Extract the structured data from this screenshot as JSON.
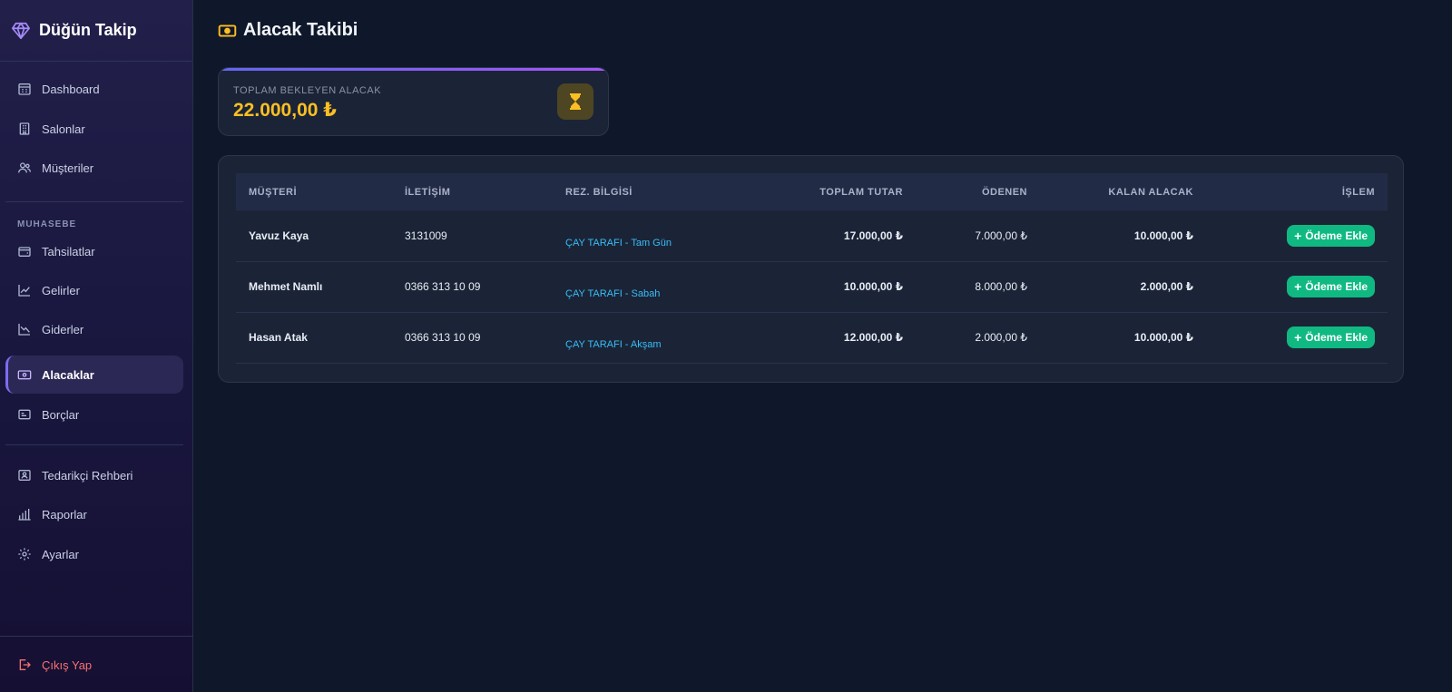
{
  "app": {
    "title": "Düğün Takip"
  },
  "sidebar": {
    "items_top": [
      {
        "label": "Dashboard",
        "icon": "calendar-grid-icon"
      },
      {
        "label": "Salonlar",
        "icon": "building-icon"
      },
      {
        "label": "Müşteriler",
        "icon": "users-icon"
      }
    ],
    "section_label": "MUHASEBE",
    "items_accounting": [
      {
        "label": "Tahsilatlar",
        "icon": "wallet-icon"
      },
      {
        "label": "Gelirler",
        "icon": "trend-up-icon"
      },
      {
        "label": "Giderler",
        "icon": "trend-down-icon"
      },
      {
        "label": "Alacaklar",
        "icon": "money-icon",
        "active": true
      },
      {
        "label": "Borçlar",
        "icon": "card-icon"
      }
    ],
    "items_bottom": [
      {
        "label": "Tedarikçi Rehberi",
        "icon": "contact-card-icon"
      },
      {
        "label": "Raporlar",
        "icon": "bar-chart-icon"
      },
      {
        "label": "Ayarlar",
        "icon": "gear-icon"
      }
    ],
    "logout_label": "Çıkış Yap"
  },
  "page": {
    "title": "Alacak Takibi"
  },
  "summary": {
    "label": "TOPLAM BEKLEYEN ALACAK",
    "value": "22.000,00 ₺"
  },
  "table": {
    "headers": [
      "MÜŞTERİ",
      "İLETİŞİM",
      "REZ. BİLGİSİ",
      "TOPLAM TUTAR",
      "ÖDENEN",
      "KALAN ALACAK",
      "İŞLEM"
    ],
    "action_label": "Ödeme Ekle",
    "rows": [
      {
        "customer": "Yavuz Kaya",
        "contact": "3131009",
        "rez": "ÇAY TARAFI - Tam Gün",
        "total": "17.000,00 ₺",
        "paid": "7.000,00 ₺",
        "remaining": "10.000,00 ₺"
      },
      {
        "customer": "Mehmet Namlı",
        "contact": "0366 313 10 09",
        "rez": "ÇAY TARAFI - Sabah",
        "total": "10.000,00 ₺",
        "paid": "8.000,00 ₺",
        "remaining": "2.000,00 ₺"
      },
      {
        "customer": "Hasan Atak",
        "contact": "0366 313 10 09",
        "rez": "ÇAY TARAFI - Akşam",
        "total": "12.000,00 ₺",
        "paid": "2.000,00 ₺",
        "remaining": "10.000,00 ₺"
      }
    ]
  },
  "colors": {
    "accent": "#7c6cf0",
    "amount": "#fbbf24",
    "success": "#10b981",
    "link": "#38bdf8",
    "danger": "#f87171"
  }
}
